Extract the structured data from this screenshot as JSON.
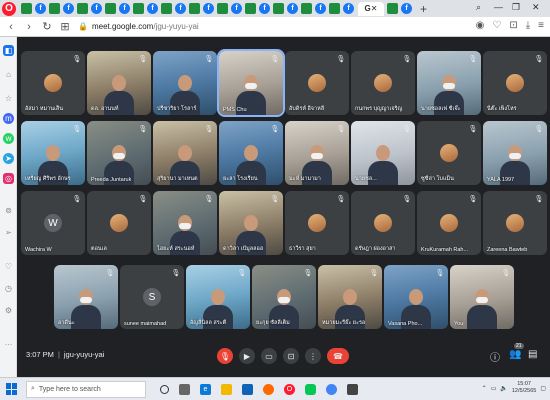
{
  "browser": {
    "active_tab_label": "G",
    "url_host": "meet.google.com",
    "url_path": "/jgu-yuyu-yai"
  },
  "meet": {
    "time": "3:07 PM",
    "meeting_code": "jgu-yuyu-yai",
    "participant_count": "21",
    "tiles": [
      {
        "name": "อัสมา หมานเส็น",
        "avatar": "photo"
      },
      {
        "name": "ดล. อานนท์",
        "avatar": ""
      },
      {
        "name": "ปรีซาริยา โรลาร์",
        "avatar": ""
      },
      {
        "name": "PMS Chu",
        "avatar": ""
      },
      {
        "name": "อับดิรห์ อีจาหลี",
        "avatar": "photo"
      },
      {
        "name": "กนกพร บุญญาเจริญ",
        "avatar": "photo"
      },
      {
        "name": "นายซอลเฟ ซีเจ๊ะ",
        "avatar": ""
      },
      {
        "name": "นีต๊ะ เพ็งโหร",
        "avatar": "photo"
      },
      {
        "name": "เหรียญ ศิริพร อักษร",
        "avatar": ""
      },
      {
        "name": "Preeda Juntaruk",
        "avatar": ""
      },
      {
        "name": "สุริยานา มาเหนต",
        "avatar": ""
      },
      {
        "name": "ยะลา โรงเรียน",
        "avatar": ""
      },
      {
        "name": "มะห์ มามามา",
        "avatar": ""
      },
      {
        "name": "นายชล...",
        "avatar": ""
      },
      {
        "name": "ซูซีล่า โบแม็น",
        "avatar": "photo"
      },
      {
        "name": "YALA 1997",
        "avatar": ""
      },
      {
        "name": "Wachira W",
        "avatar": "W"
      },
      {
        "name": "ตอนเล",
        "avatar": "photo"
      },
      {
        "name": "ไฮยะห์ สระนอห์",
        "avatar": ""
      },
      {
        "name": "ดาวิลา เป้มูลลอฮ",
        "avatar": ""
      },
      {
        "name": "ธาวีรา สุยา",
        "avatar": "photo"
      },
      {
        "name": "ดรัษฎา ผ่องอาสา",
        "avatar": "photo"
      },
      {
        "name": "KruKuramah Rah...",
        "avatar": "photo"
      },
      {
        "name": "Zareena Bawteb",
        "avatar": "photo"
      },
      {
        "name": "อาดีนะ",
        "avatar": ""
      },
      {
        "name": "sunee maimahad",
        "avatar": "S"
      },
      {
        "name": "อัญลีนิลล สระตี",
        "avatar": ""
      },
      {
        "name": "ยะกุย ซัลลีเต็ม",
        "avatar": ""
      },
      {
        "name": "หมายมะรีย๊ะ ยะรอ",
        "avatar": ""
      },
      {
        "name": "Vasana Pho...",
        "avatar": ""
      },
      {
        "name": "You",
        "avatar": ""
      }
    ]
  },
  "taskbar": {
    "search_placeholder": "Type here to search",
    "time": "15:07",
    "date": "12/5/2565"
  }
}
